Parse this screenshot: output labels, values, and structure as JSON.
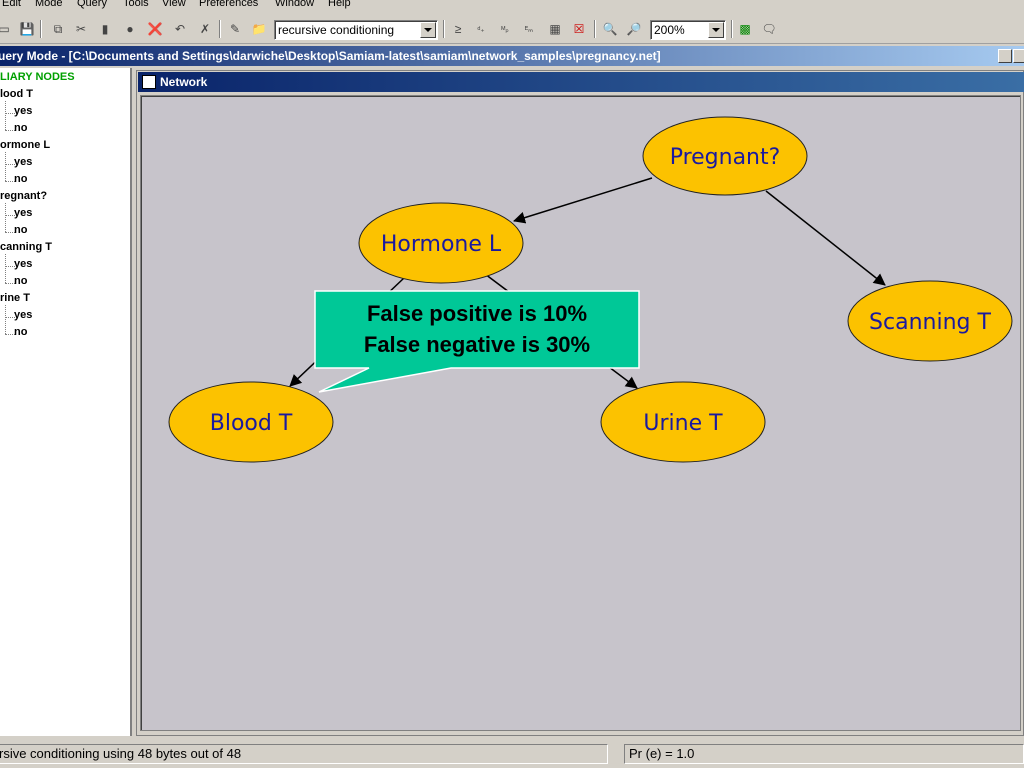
{
  "menu": [
    "Edit",
    "Mode",
    "Query",
    "Tools",
    "View",
    "Preferences",
    "Window",
    "Help"
  ],
  "toolbar": {
    "algorithm": "recursive conditioning",
    "zoom": "200%",
    "icon_names": [
      "close-icon",
      "save-icon",
      "copy-icon",
      "cut-icon",
      "paste-icon",
      "record-icon",
      "delete-icon",
      "route-icon",
      "scissors-icon",
      "edit-icon",
      "folder-icon",
      "geq-icon",
      "mpe-icon",
      "map-icon",
      "epm-icon",
      "table-icon",
      "clear-icon",
      "zoom-in-icon",
      "zoom-out-icon",
      "help-icon",
      "comment-icon"
    ]
  },
  "window": {
    "title": "uery Mode - [C:\\Documents and Settings\\darwiche\\Desktop\\Samiam-latest\\samiam\\network_samples\\pregnancy.net]"
  },
  "tree": {
    "root": "LIARY NODES",
    "nodes": [
      {
        "label": "lood T",
        "states": [
          "yes",
          "no"
        ]
      },
      {
        "label": "ormone L",
        "states": [
          "yes",
          "no"
        ]
      },
      {
        "label": "regnant?",
        "states": [
          "yes",
          "no"
        ]
      },
      {
        "label": "canning T",
        "states": [
          "yes",
          "no"
        ]
      },
      {
        "label": "rine T",
        "states": [
          "yes",
          "no"
        ]
      }
    ]
  },
  "network": {
    "frame_title": "Network",
    "node_color": "#fcc200",
    "node_text_color": "#1a1aa0",
    "callout_color": "#00c897",
    "nodes": {
      "pregnant": "Pregnant?",
      "hormone": "Hormone L",
      "scanning": "Scanning T",
      "blood": "Blood T",
      "urine": "Urine T"
    },
    "edges": [
      [
        "Pregnant?",
        "Hormone L"
      ],
      [
        "Pregnant?",
        "Scanning T"
      ],
      [
        "Hormone L",
        "Blood T"
      ],
      [
        "Hormone L",
        "Urine T"
      ]
    ],
    "callout": {
      "line1": "False positive is 10%",
      "line2": "False negative is 30%"
    }
  },
  "status": {
    "left": "rsive conditioning using 48  bytes out of 48",
    "right": "Pr (e) = 1.0"
  }
}
